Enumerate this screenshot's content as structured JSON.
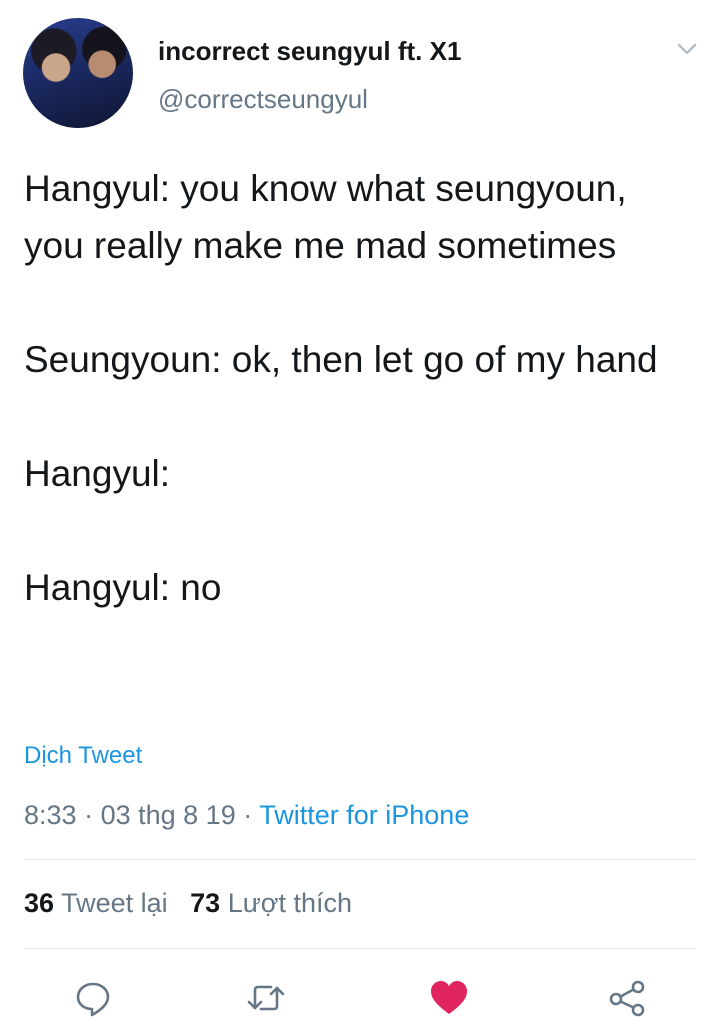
{
  "author": {
    "name": "incorrect seungyul ft. X1",
    "handle": "@correctseungyul"
  },
  "tweet": {
    "paragraphs": [
      "Hangyul: you know what seungyoun, you really make me mad sometimes",
      "Seungyoun: ok, then let go of my hand",
      "Hangyul:",
      "Hangyul: no"
    ]
  },
  "translate_label": "Dịch Tweet",
  "meta": {
    "time": "8:33",
    "date": "03 thg 8 19",
    "separator": "·",
    "source": "Twitter for iPhone"
  },
  "stats": {
    "retweets_count": "36",
    "retweets_label": "Tweet lại",
    "likes_count": "73",
    "likes_label": "Lượt thích"
  },
  "icons": {
    "reply": "reply-icon",
    "retweet": "retweet-icon",
    "like": "heart-icon",
    "share": "share-icon",
    "menu": "chevron-down-icon"
  },
  "colors": {
    "accent": "#1b95e0",
    "like": "#e0245e",
    "muted": "#657786",
    "text": "#14171a"
  }
}
